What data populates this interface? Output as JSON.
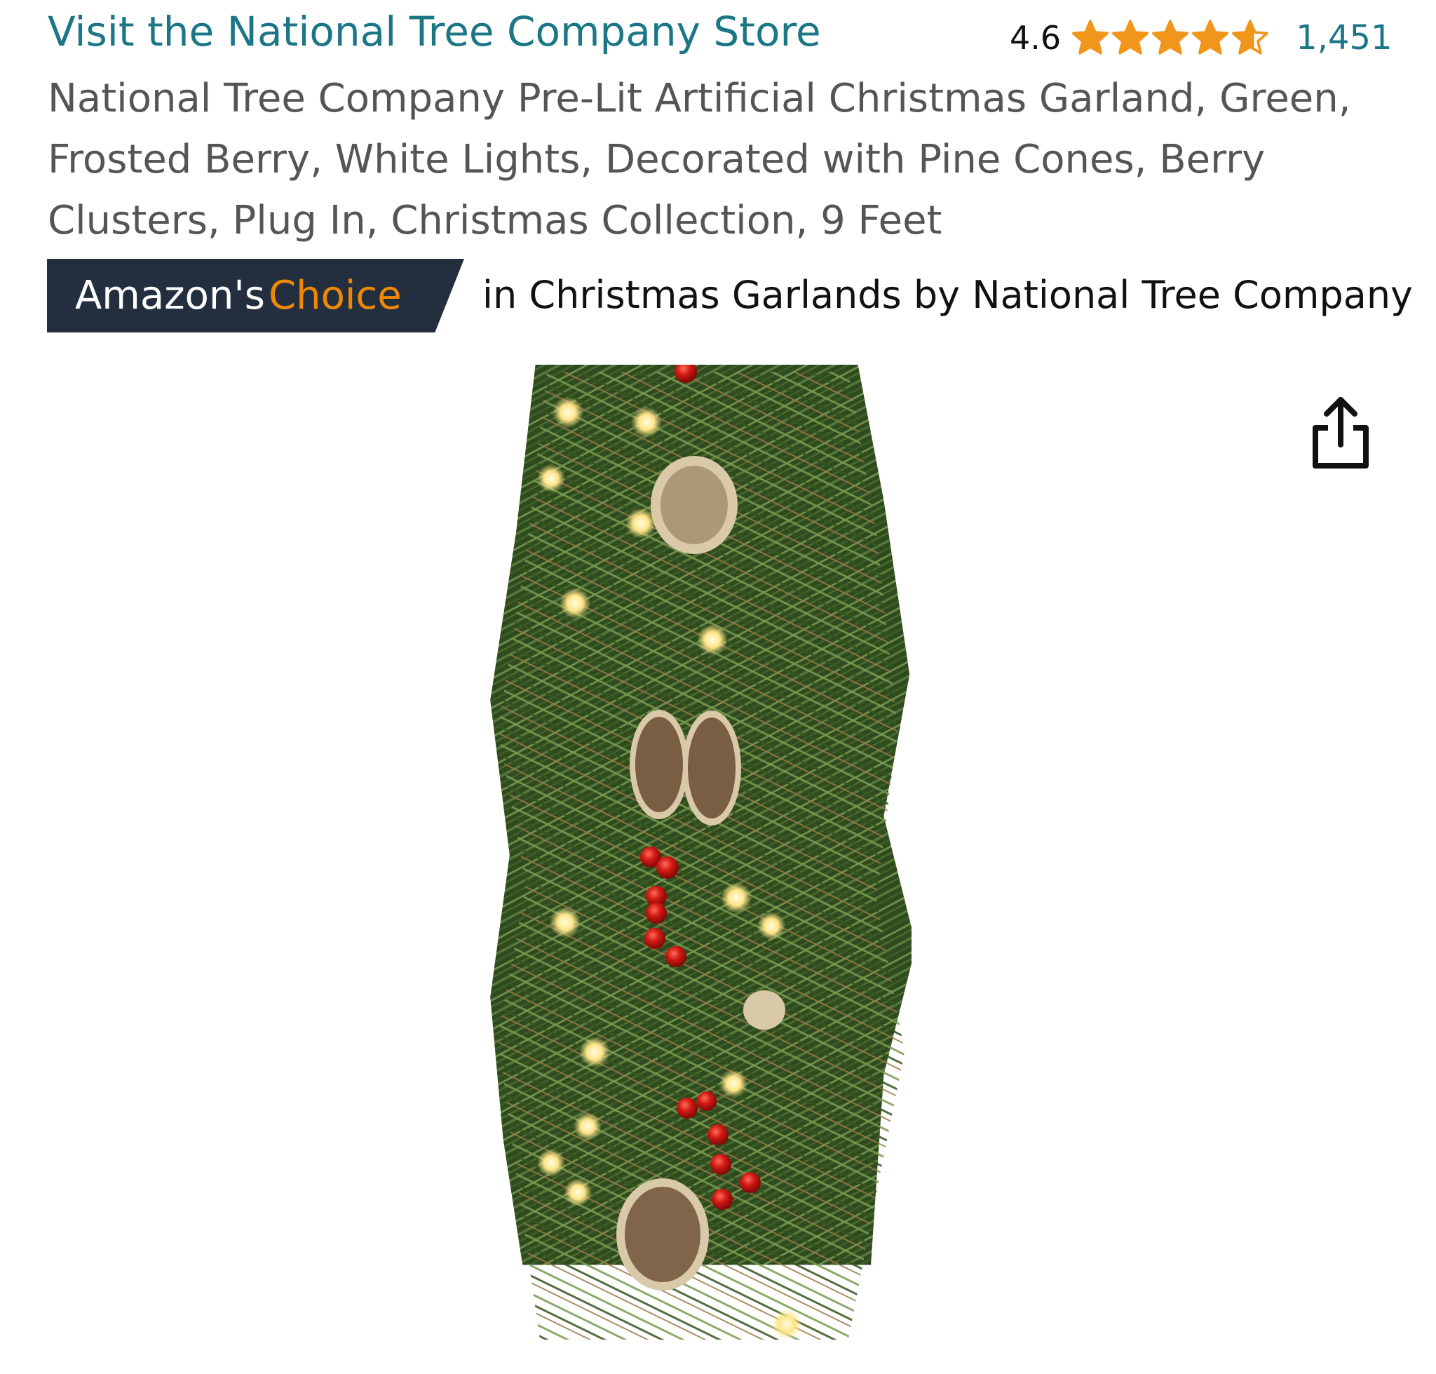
{
  "store": {
    "link_label": "Visit the National Tree Company Store"
  },
  "rating": {
    "value": "4.6",
    "stars": 4.6,
    "count": "1,451",
    "star_color": "#f1961b"
  },
  "product": {
    "title": "National Tree Company Pre-Lit Artificial Christmas Garland, Green, Frosted Berry, White Lights, Decorated with Pine Cones, Berry Clusters, Plug In, Christmas Collection, 9 Feet"
  },
  "badge": {
    "prefix": "Amazon's",
    "highlight": "Choice",
    "category_text": "in Christmas Garlands by National Tree Company",
    "background_color": "#232f3e",
    "highlight_color": "#f08804"
  },
  "icons": {
    "share": "share-icon",
    "star": "star-icon"
  },
  "colors": {
    "link": "#1b7685",
    "title_text": "#555555"
  }
}
